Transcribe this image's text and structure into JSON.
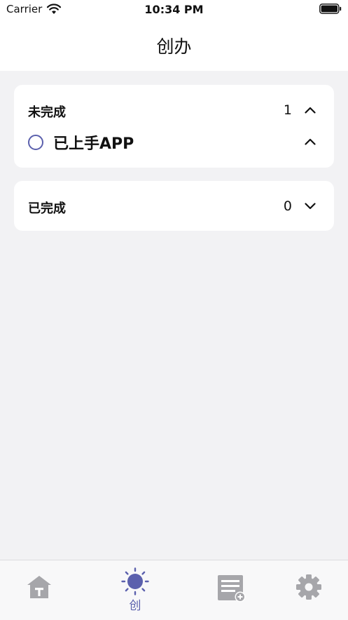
{
  "status_bar": {
    "carrier": "Carrier",
    "time": "10:34 PM"
  },
  "header": {
    "title": "创办"
  },
  "sections": {
    "todo": {
      "title": "未完成",
      "count": "1",
      "expanded": true,
      "tasks": [
        {
          "label": "已上手APP",
          "done": false
        }
      ]
    },
    "done": {
      "title": "已完成",
      "count": "0",
      "expanded": false
    }
  },
  "tab_bar": {
    "tabs": [
      {
        "id": "home",
        "icon": "home-icon",
        "label": "",
        "active": false
      },
      {
        "id": "create",
        "icon": "sun-icon",
        "label": "创",
        "active": true
      },
      {
        "id": "list",
        "icon": "list-add-icon",
        "label": "",
        "active": false
      },
      {
        "id": "settings",
        "icon": "gear-icon",
        "label": "",
        "active": false
      }
    ]
  },
  "colors": {
    "accent": "#5b60ad",
    "inactive_icon": "#a6a6aa",
    "background": "#f2f2f4",
    "card": "#ffffff"
  }
}
